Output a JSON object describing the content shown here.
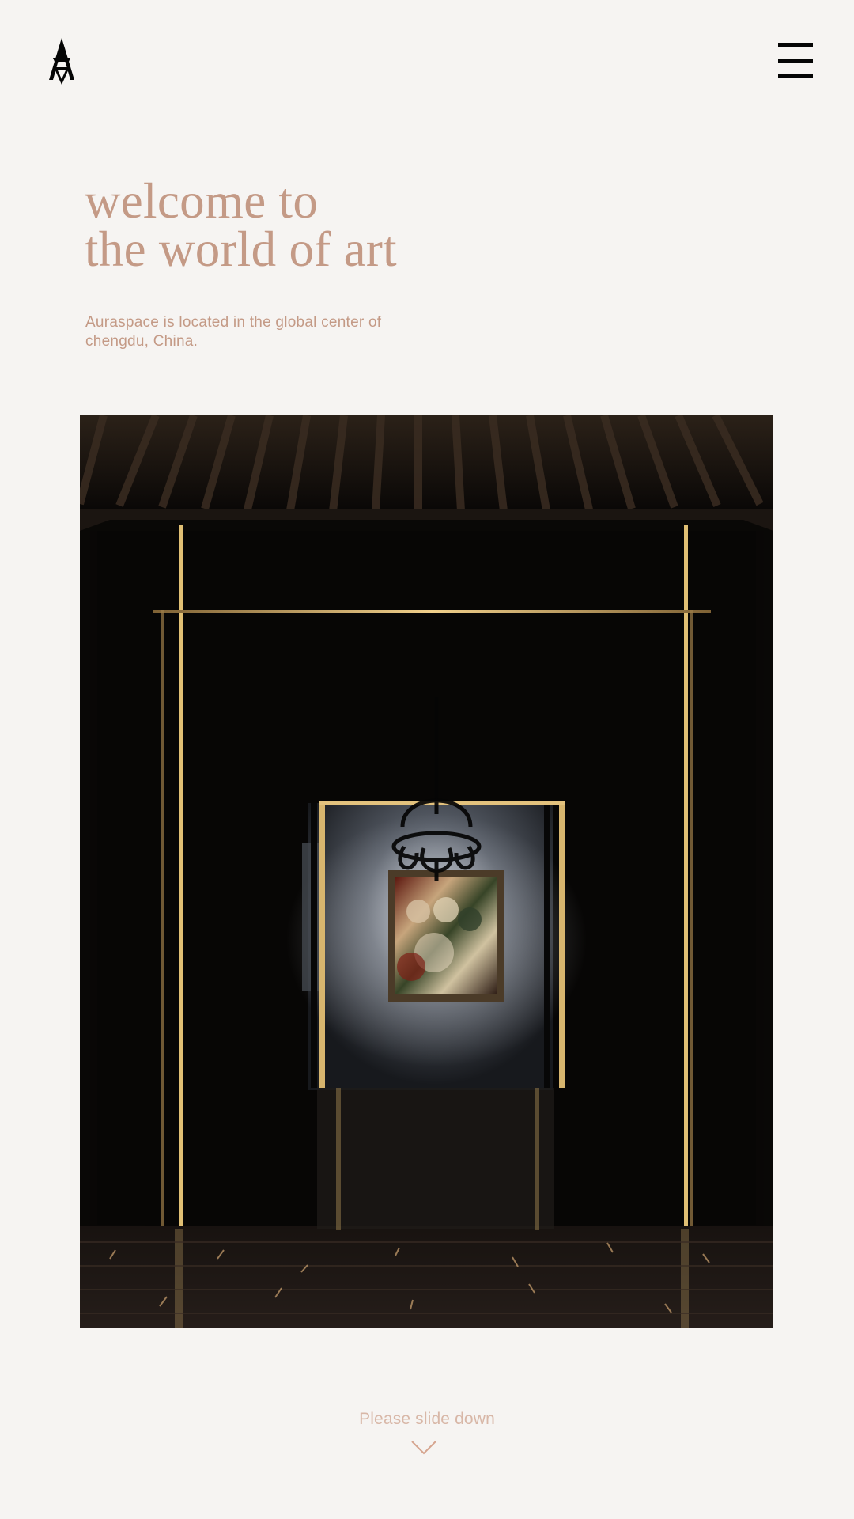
{
  "header": {
    "logo_icon": "aura-space-logo-icon",
    "menu_icon": "hamburger-menu-icon"
  },
  "hero": {
    "title_line_1": "welcome to",
    "title_line_2": "the world of art",
    "subtitle_line_1": "Auraspace is located in the global center of",
    "subtitle_line_2": "chengdu, China."
  },
  "image": {
    "subject": "gallery-corridor-image"
  },
  "footer": {
    "scroll_hint": "Please slide down",
    "chevron_icon": "chevron-down-icon"
  },
  "colors": {
    "background": "#f6f4f2",
    "accent": "#c49a86",
    "muted_accent": "#d8b7a7",
    "dark": "#050505",
    "gold_light": "#d8b26a"
  }
}
